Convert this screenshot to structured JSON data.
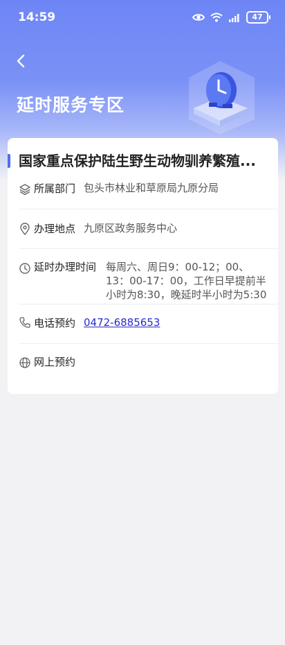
{
  "status_bar": {
    "time": "14:59",
    "battery": "47"
  },
  "header": {
    "title": "延时服务专区"
  },
  "card": {
    "title": "国家重点保护陆生野生动物驯养繁殖...",
    "rows": [
      {
        "label": "所属部门",
        "value": "包头市林业和草原局九原分局"
      },
      {
        "label": "办理地点",
        "value": "九原区政务服务中心"
      },
      {
        "label": "延时办理时间",
        "value": "每周六、周日9：00-12；00、13：00-17：00，工作日早提前半小时为8:30，晚延时半小时为5:30"
      },
      {
        "label": "电话预约",
        "value": "0472-6885653"
      },
      {
        "label": "网上预约",
        "value": ""
      }
    ]
  },
  "colors": {
    "accent": "#4e6ef2",
    "link": "#2a2ad0",
    "hero": "#6e86f5"
  }
}
